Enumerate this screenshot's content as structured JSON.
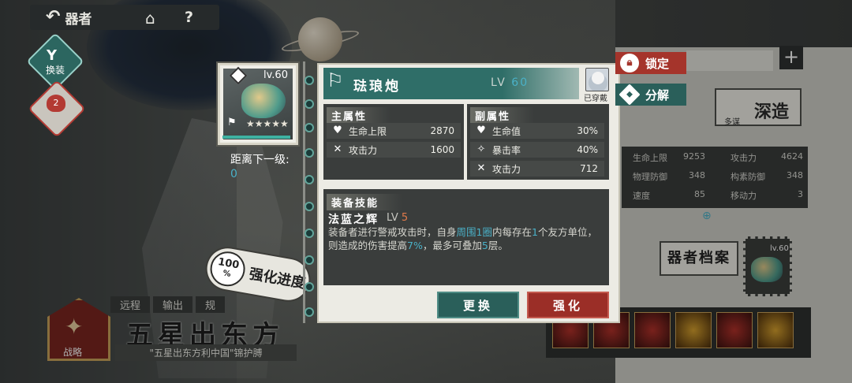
{
  "topbar": {
    "back_label": "器者",
    "back_icon": "↶",
    "home_icon": "⌂",
    "help_icon": "?"
  },
  "left_buttons": {
    "swap_label": "换装",
    "swap_icon": "Y",
    "heart_count": "2"
  },
  "item_card": {
    "level": "lv.60",
    "stars": "★★★★★"
  },
  "next_level": {
    "label": "距离下一级:",
    "value": "0"
  },
  "progress": {
    "percent": "100",
    "percent_sign": "%",
    "label": "强化进度"
  },
  "detail": {
    "name": "琺琅炮",
    "level_prefix": "LV",
    "level_value": "60",
    "equipped_label": "已穿戴",
    "main_attr_title": "主属性",
    "sub_attr_title": "副属性",
    "main_attrs": [
      {
        "icon": "♥",
        "name": "生命上限",
        "value": "2870"
      },
      {
        "icon": "✕",
        "name": "攻击力",
        "value": "1600"
      }
    ],
    "sub_attrs": [
      {
        "icon": "♥",
        "name": "生命值",
        "value": "30%"
      },
      {
        "icon": "✧",
        "name": "暴击率",
        "value": "40%"
      },
      {
        "icon": "✕",
        "name": "攻击力",
        "value": "712"
      }
    ],
    "skill_section_title": "装备技能",
    "skill_name": "法蓝之辉",
    "skill_lv_prefix": "LV",
    "skill_lv_value": "5",
    "skill_desc_parts": [
      "装备者进行警戒攻击时，自身",
      "周围1圈",
      "内每存在",
      "1",
      "个友方单位，则造成的伤害提高",
      "7%",
      "，最多可叠加",
      "5",
      "层。"
    ],
    "swap_button": "更换",
    "enhance_button": "强化"
  },
  "side_tabs": {
    "lock_label": "锁定",
    "dismantle_label": "分解"
  },
  "background": {
    "deep_forge": "深造",
    "deep_sub": "多谋",
    "archive_label": "器者档案",
    "stamp_level": "lv.60",
    "right_stats": [
      {
        "name": "生命上限",
        "value": "9253"
      },
      {
        "name": "攻击力",
        "value": "4624"
      },
      {
        "name": "物理防御",
        "value": "348"
      },
      {
        "name": "构素防御",
        "value": "348"
      },
      {
        "name": "速度",
        "value": "85"
      },
      {
        "name": "移动力",
        "value": "3"
      }
    ],
    "buffs": [
      "",
      "",
      "",
      "",
      "",
      ""
    ],
    "tags": [
      "远程",
      "输出",
      "规"
    ],
    "set_title": "五星出东方",
    "set_subtitle": "\"五星出东方利中国\"锦护膊",
    "strategy_label": "战略"
  },
  "colors": {
    "teal": "#2f6e68",
    "red": "#9b2e27",
    "highlight": "#4ab1c8",
    "skill_level": "#e07a4a"
  }
}
